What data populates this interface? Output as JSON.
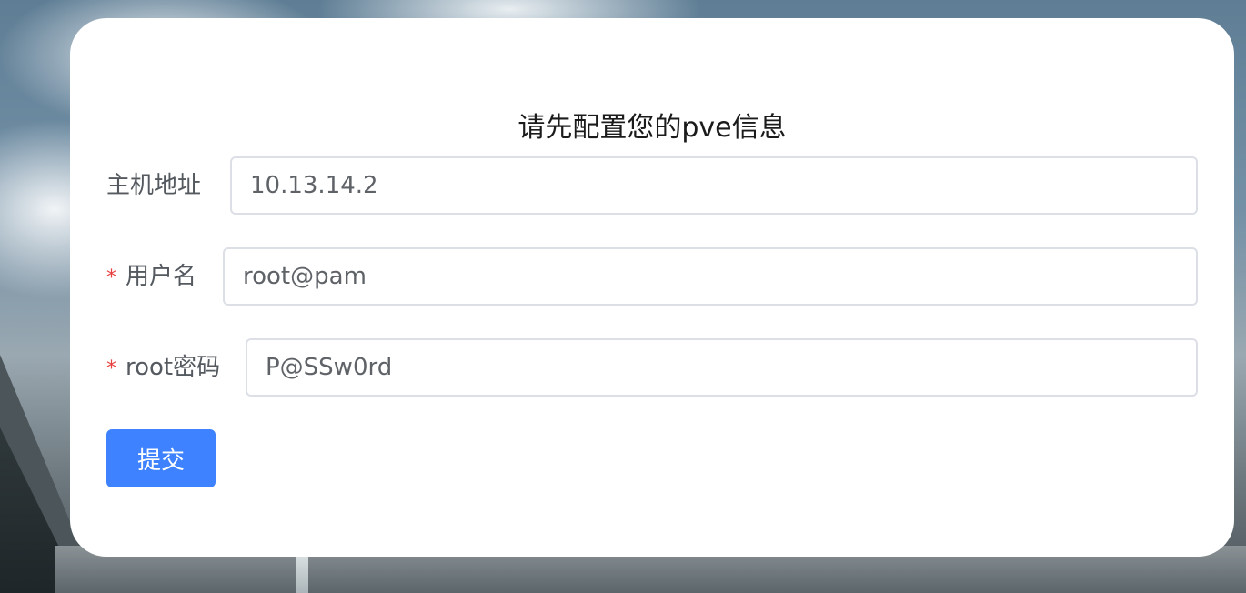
{
  "form": {
    "title": "请先配置您的pve信息",
    "fields": [
      {
        "label": "主机地址",
        "required": false,
        "value": "10.13.14.2",
        "placeholder": ""
      },
      {
        "label": "用户名",
        "required": true,
        "value": "root@pam",
        "placeholder": ""
      },
      {
        "label": "root密码",
        "required": true,
        "value": "P@SSw0rd",
        "placeholder": ""
      }
    ],
    "required_mark": "*",
    "submit_label": "提交"
  },
  "colors": {
    "accent": "#3f82ff",
    "required": "#e6413f",
    "card_bg": "#ffffff",
    "border": "#dcdfe6"
  }
}
